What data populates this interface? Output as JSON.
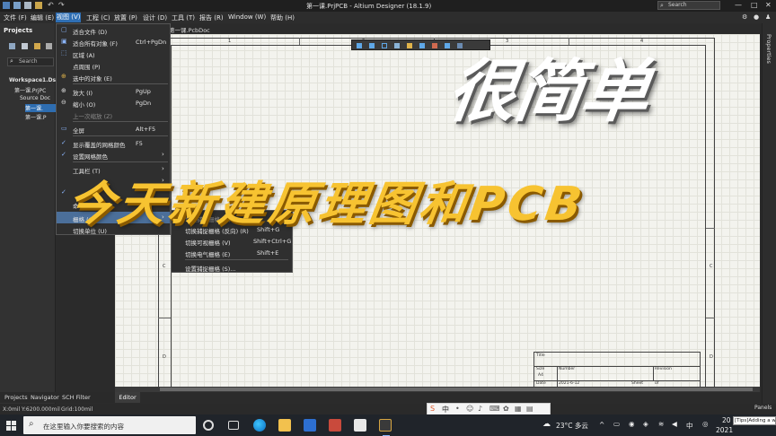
{
  "window": {
    "title": "第一课.PrjPCB - Altium Designer (18.1.9)",
    "search_placeholder": "Search"
  },
  "menubar": {
    "items": [
      "文件 (F)",
      "编辑 (E)",
      "视图 (V)",
      "工程 (C)",
      "放置 (P)",
      "设计 (D)",
      "工具 (T)",
      "报告 (R)",
      "Window (W)",
      "帮助 (H)"
    ]
  },
  "projects_panel": {
    "title": "Projects",
    "search_placeholder": "Search",
    "tree": [
      "Workspace1.Ds",
      "第一课.PrjPC",
      "Source Doc",
      "第一课.",
      "第一课.P"
    ]
  },
  "view_menu": {
    "items": [
      {
        "label": "适合文件 (D)",
        "shortcut": ""
      },
      {
        "label": "适合所有对象 (F)",
        "shortcut": "Ctrl+PgDn"
      },
      {
        "label": "区域 (A)",
        "shortcut": ""
      },
      {
        "label": "点周围 (P)",
        "shortcut": ""
      },
      {
        "label": "选中的对象 (E)",
        "shortcut": ""
      },
      {
        "label": "放大 (I)",
        "shortcut": "PgUp"
      },
      {
        "label": "缩小 (O)",
        "shortcut": "PgDn"
      },
      {
        "label": "上一次缩放 (Z)",
        "shortcut": ""
      },
      {
        "label": "全屏",
        "shortcut": "Alt+F5"
      },
      {
        "label": "显示覆盖的网格颜色",
        "shortcut": "F5"
      },
      {
        "label": "设置网格颜色",
        "shortcut": ""
      },
      {
        "label": "工具栏 (T)",
        "shortcut": ""
      },
      {
        "label": "",
        "shortcut": ""
      },
      {
        "label": "命令状态 (B)",
        "shortcut": ""
      },
      {
        "label": "栅格 (G)",
        "shortcut": ""
      },
      {
        "label": "切换单位 (U)",
        "shortcut": ""
      }
    ]
  },
  "grid_submenu": {
    "items": [
      {
        "label": "切换捕捉栅格 (G)",
        "shortcut": "G"
      },
      {
        "label": "切换捕捉栅格 (反向) (R)",
        "shortcut": "Shift+G"
      },
      {
        "label": "切换可视栅格 (V)",
        "shortcut": "Shift+Ctrl+G"
      },
      {
        "label": "切换电气栅格 (E)",
        "shortcut": "Shift+E"
      },
      {
        "label": "设置捕捉栅格 (S)...",
        "shortcut": ""
      }
    ]
  },
  "document": {
    "tab": "第一课.PcbDoc",
    "zone_cols": [
      "1",
      "2",
      "3",
      "4"
    ],
    "zone_rows": [
      "C",
      "D"
    ],
    "titleblock": {
      "title_label": "Title",
      "size_label": "Size",
      "size_value": "A4",
      "number_label": "Number",
      "revision_label": "Revision",
      "date_label": "Date",
      "date_value": "2021-6-12",
      "sheet_label": "Sheet",
      "of_label": "of"
    }
  },
  "panel_tabs": [
    "Projects",
    "Navigator",
    "SCH Filter"
  ],
  "editor_tab": "Editor",
  "properties_tab": "Properties",
  "status": {
    "coords": "X:0mil Y:6200.000mil",
    "grid": "Grid:100mil",
    "panels": "Panels"
  },
  "overlay": {
    "line1": "很简单",
    "line2": "今天新建原理图和PCB"
  },
  "taskbar": {
    "search_placeholder": "在这里输入你要搜索的内容",
    "temperature": "23°C 多云",
    "ime_mode": "中",
    "clock_top": "20",
    "clock_bottom": "2021",
    "tip": "[Tips]Adding a w"
  },
  "ime_bar": {
    "label": "中"
  },
  "colors": {
    "accent": "#2f6fb4",
    "overlay_yellow": "#f7c331",
    "canvas": "#f3f3ee"
  }
}
